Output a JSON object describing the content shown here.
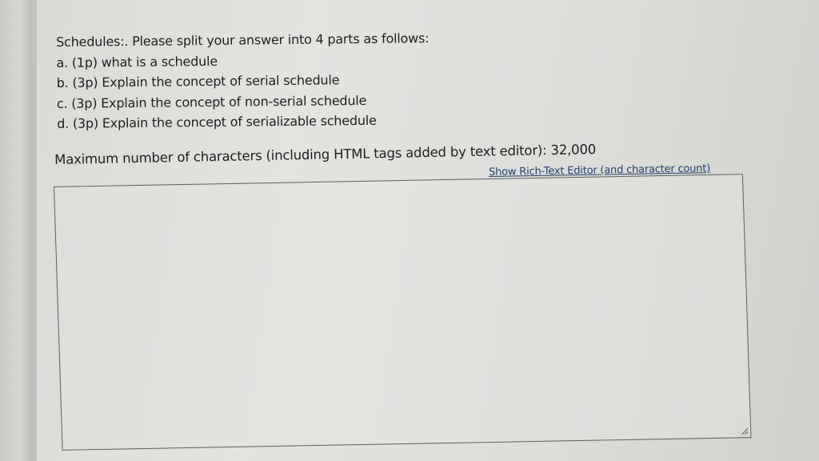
{
  "question": {
    "title": "Schedules:. Please split your answer into 4 parts as follows:",
    "parts": [
      "a. (1p) what is a schedule",
      "b. (3p) Explain the concept of serial schedule",
      "c. (3p) Explain the concept of non-serial schedule",
      "d. (3p) Explain the concept of serializable schedule"
    ]
  },
  "editor": {
    "max_chars_label": "Maximum number of characters (including HTML tags added by text editor): 32,000",
    "rich_text_link": "Show Rich-Text Editor (and character count)",
    "answer_value": ""
  }
}
